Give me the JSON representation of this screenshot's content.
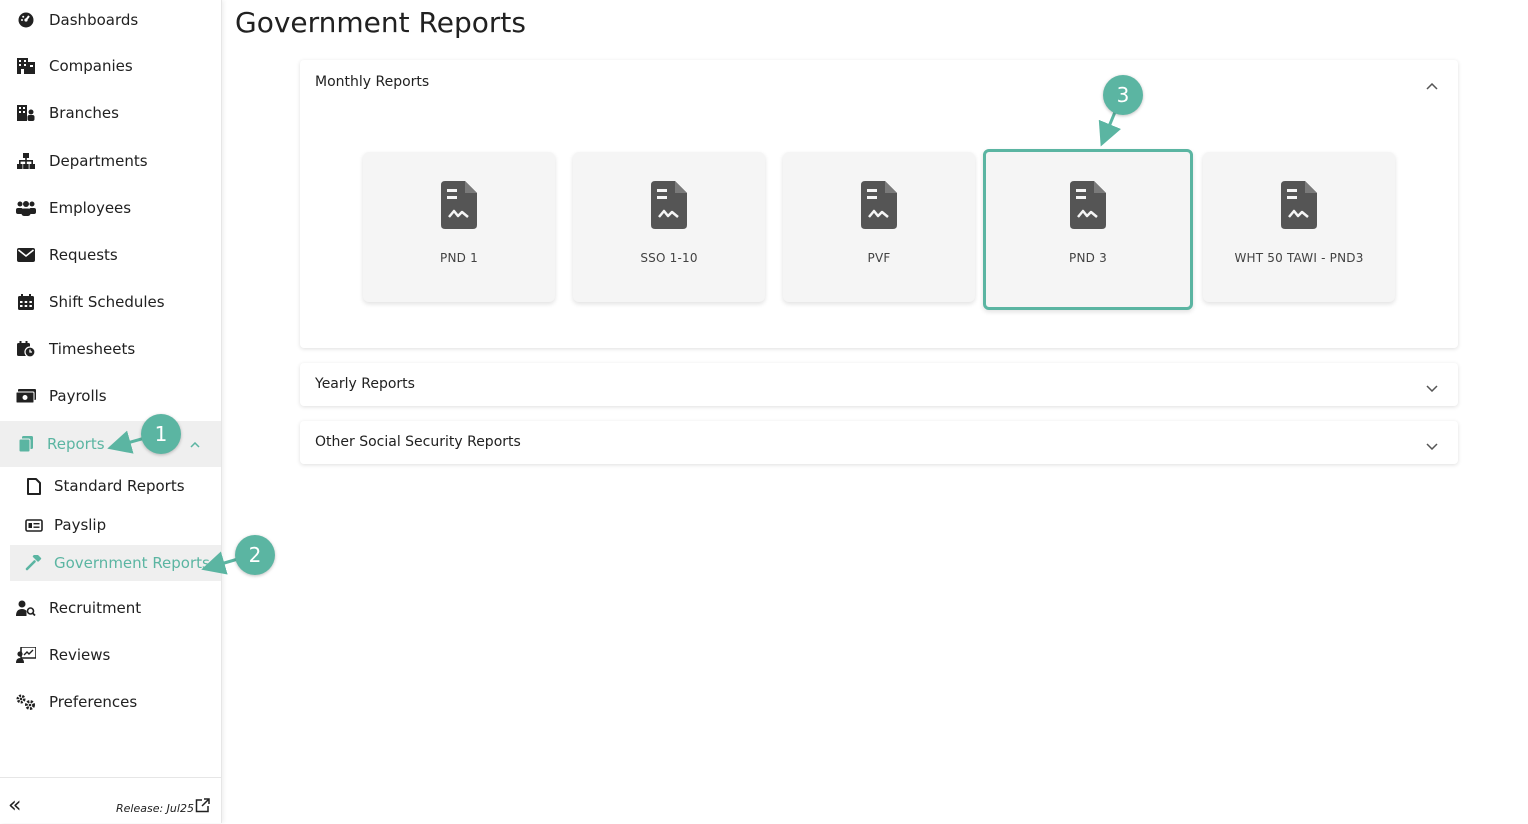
{
  "sidebar": {
    "items": [
      {
        "label": "Dashboards",
        "icon": "dashboard-icon"
      },
      {
        "label": "Companies",
        "icon": "companies-icon"
      },
      {
        "label": "Branches",
        "icon": "branches-icon"
      },
      {
        "label": "Departments",
        "icon": "departments-icon"
      },
      {
        "label": "Employees",
        "icon": "employees-icon"
      },
      {
        "label": "Requests",
        "icon": "envelope-icon"
      },
      {
        "label": "Shift Schedules",
        "icon": "calendar-icon"
      },
      {
        "label": "Timesheets",
        "icon": "timesheet-icon"
      },
      {
        "label": "Payrolls",
        "icon": "money-icon"
      },
      {
        "label": "Reports",
        "icon": "reports-icon"
      },
      {
        "label": "Recruitment",
        "icon": "recruitment-icon"
      },
      {
        "label": "Reviews",
        "icon": "reviews-icon"
      },
      {
        "label": "Preferences",
        "icon": "gears-icon"
      }
    ],
    "sub_items": [
      {
        "label": "Standard Reports",
        "icon": "file-icon"
      },
      {
        "label": "Payslip",
        "icon": "payslip-icon"
      },
      {
        "label": "Government Reports",
        "icon": "gavel-icon"
      }
    ],
    "footer": {
      "collapse": "«",
      "release": "Release: Jul25"
    }
  },
  "page": {
    "title": "Government Reports"
  },
  "sections": [
    {
      "title": "Monthly Reports",
      "expanded": true,
      "cards": [
        {
          "label": "PND 1"
        },
        {
          "label": "SSO 1-10"
        },
        {
          "label": "PVF"
        },
        {
          "label": "PND 3"
        },
        {
          "label": "WHT 50 TAWI - PND3"
        }
      ]
    },
    {
      "title": "Yearly Reports",
      "expanded": false
    },
    {
      "title": "Other Social Security Reports",
      "expanded": false
    }
  ],
  "annotations": [
    "1",
    "2",
    "3"
  ],
  "colors": {
    "accent": "#5bb5a2",
    "card_bg": "#f5f5f5",
    "icon": "#555555"
  }
}
